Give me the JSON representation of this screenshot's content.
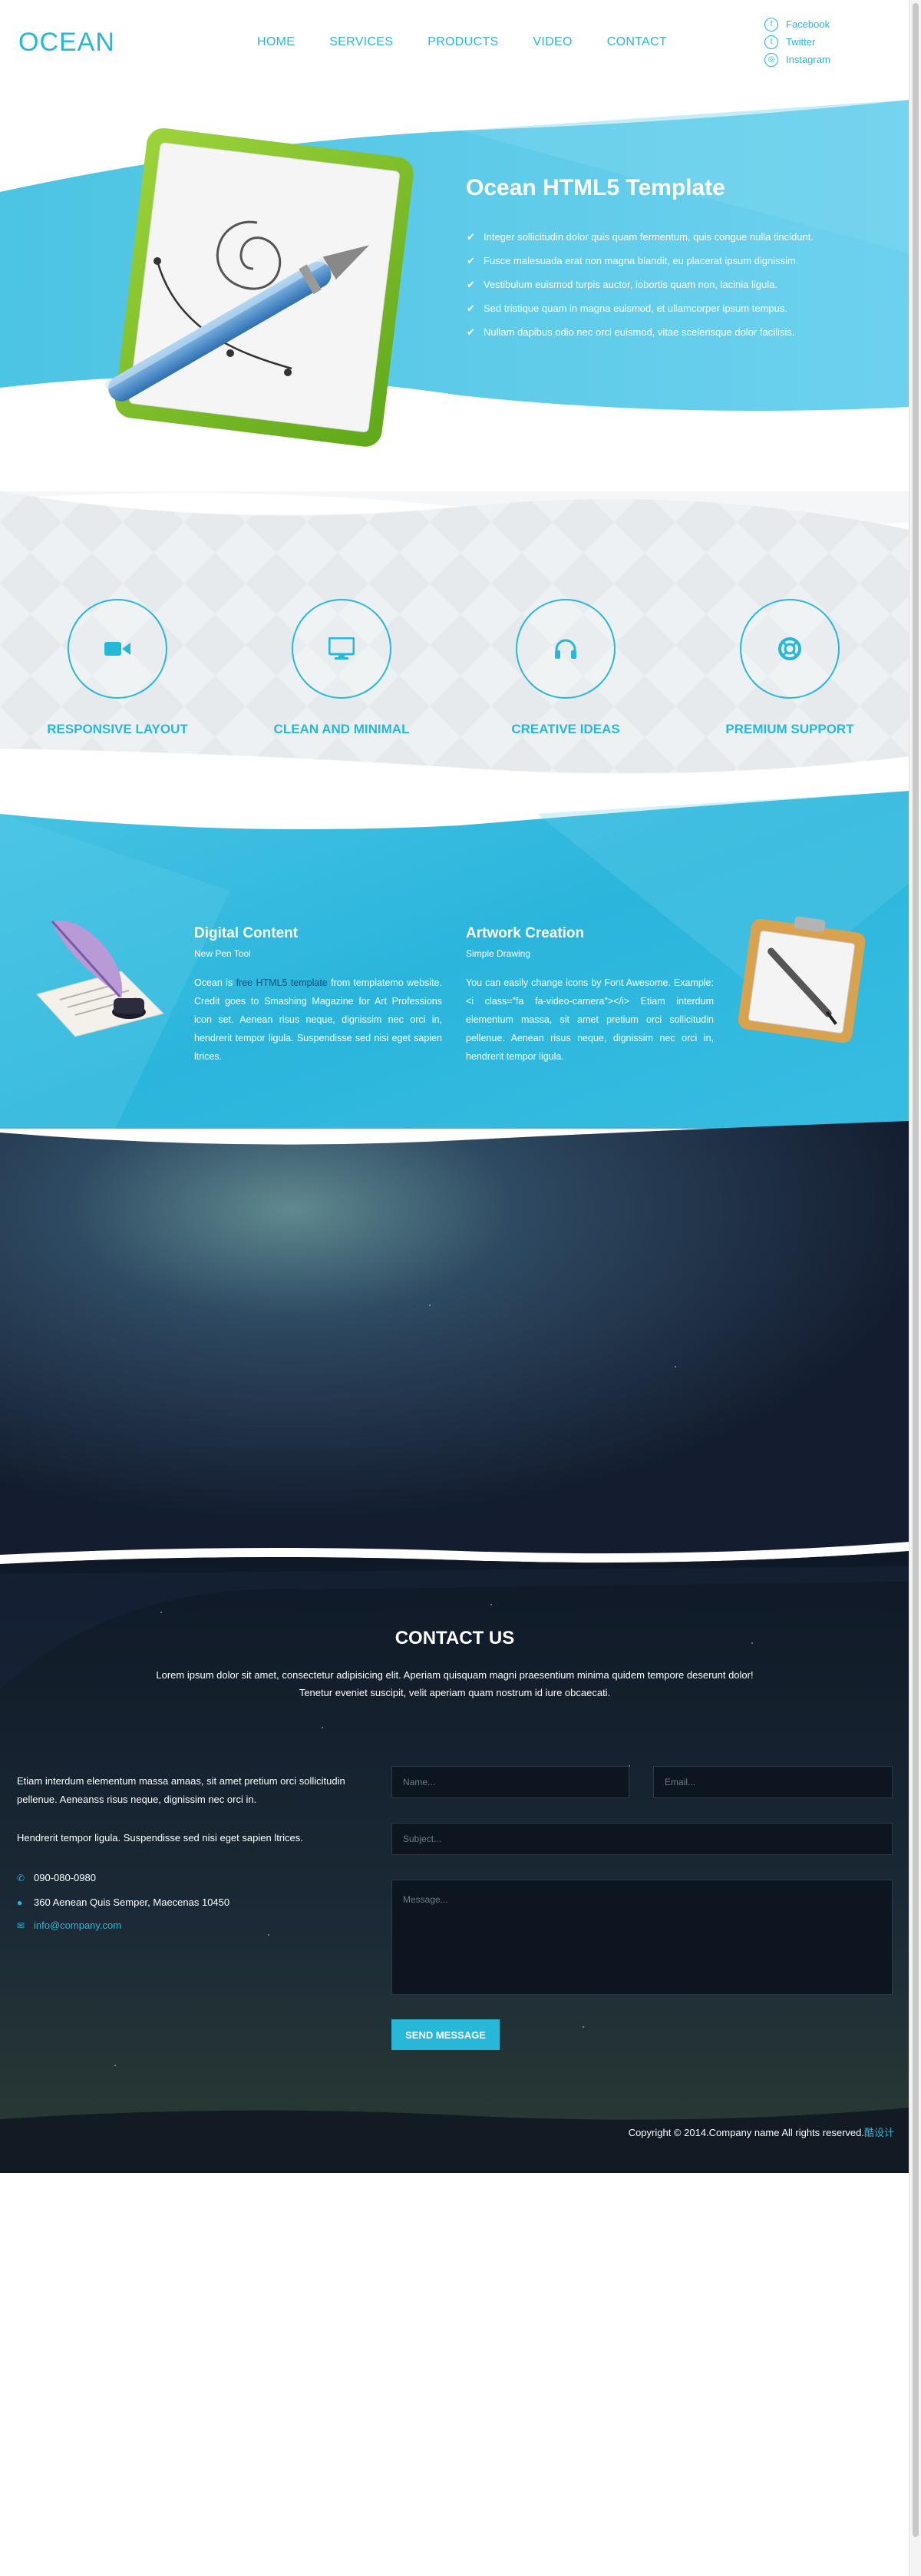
{
  "header": {
    "logo": "OCEAN",
    "nav": [
      "HOME",
      "SERVICES",
      "PRODUCTS",
      "VIDEO",
      "CONTACT"
    ],
    "social": [
      {
        "icon": "facebook-icon",
        "glyph": "f",
        "label": "Facebook"
      },
      {
        "icon": "twitter-icon",
        "glyph": "t",
        "label": "Twitter"
      },
      {
        "icon": "instagram-icon",
        "glyph": "◎",
        "label": "Instagram"
      }
    ]
  },
  "hero": {
    "title": "Ocean HTML5 Template",
    "items": [
      "Integer sollicitudin dolor quis quam fermentum, quis congue nulla tincidunt.",
      "Fusce malesuada erat non magna blandit, eu placerat ipsum dignissim.",
      "Vestibulum euismod turpis auctor, lobortis quam non, lacinia ligula.",
      "Sed tristique quam in magna euismod, et ullamcorper ipsum tempus.",
      "Nullam dapibus odio nec orci euismod, vitae scelerisque dolor facilisis."
    ]
  },
  "features": [
    {
      "icon": "video-camera-icon",
      "label": "RESPONSIVE LAYOUT"
    },
    {
      "icon": "monitor-icon",
      "label": "CLEAN AND MINIMAL"
    },
    {
      "icon": "headphones-icon",
      "label": "CREATIVE IDEAS"
    },
    {
      "icon": "life-ring-icon",
      "label": "PREMIUM SUPPORT"
    }
  ],
  "content": {
    "left": {
      "title": "Digital Content",
      "subtitle": "New Pen Tool",
      "text_before": "Ocean is ",
      "link": "free HTML5 template",
      "text_after": " from templatemo website. Credit goes to Smashing Magazine for Art Professions icon set. Aenean risus neque, dignissim nec orci in, hendrerit tempor ligula. Suspendisse sed nisi eget sapien ltrices."
    },
    "right": {
      "title": "Artwork Creation",
      "subtitle": "Simple Drawing",
      "text": "You can easily change icons by Font Awesome. Example: <i class=\"fa fa-video-camera\"></i> Etiam interdum elementum massa, sit amet pretium orci sollicitudin pellenue. Aenean risus neque, dignissim nec orci in, hendrerit tempor ligula."
    }
  },
  "contact": {
    "title": "CONTACT US",
    "lead_1": "Lorem ipsum dolor sit amet, consectetur adipisicing elit. Aperiam quisquam magni praesentium minima quidem tempore deserunt dolor!",
    "lead_2": "Tenetur eveniet suscipit, velit aperiam quam nostrum id iure obcaecati.",
    "para_1": "Etiam interdum elementum massa amaas, sit amet pretium orci sollicitudin pellenue. Aeneanss risus neque, dignissim nec orci in.",
    "para_2": "Hendrerit tempor ligula. Suspendisse sed nisi eget sapien ltrices.",
    "phone": "090-080-0980",
    "address": "360 Aenean Quis Semper, Maecenas 10450",
    "email": "info@company.com",
    "form": {
      "name_placeholder": "Name...",
      "email_placeholder": "Email...",
      "subject_placeholder": "Subject...",
      "message_placeholder": "Message...",
      "send_label": "SEND MESSAGE"
    }
  },
  "footer": {
    "copyright": "Copyright © 2014.Company name All rights reserved.",
    "link": "酷设计"
  },
  "colors": {
    "accent": "#27b7d8",
    "dark": "#111b27"
  }
}
